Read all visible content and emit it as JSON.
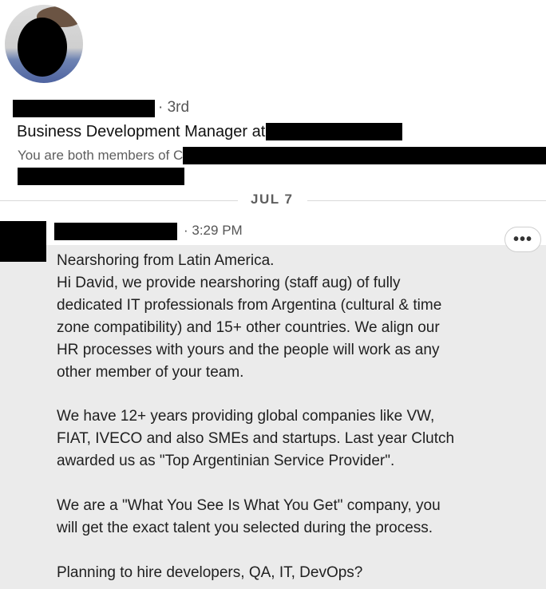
{
  "profile": {
    "degree": "· 3rd",
    "headline_prefix": "Business Development Manager at",
    "shared_prefix": "You are both members of C"
  },
  "divider": {
    "date": "JUL 7"
  },
  "message": {
    "time": "· 3:29 PM",
    "more_label": "•••",
    "lines": [
      "Nearshoring from Latin America.",
      "Hi David, we provide nearshoring (staff aug) of fully",
      "dedicated IT professionals from Argentina (cultural & time",
      "zone compatibility) and 15+ other countries. We align our",
      "HR processes with yours and the people will work as any",
      "other member of your team.",
      "",
      "We have 12+ years providing global companies like VW,",
      "FIAT, IVECO and also SMEs and startups. Last year Clutch",
      "awarded us as \"Top Argentinian Service Provider\".",
      "",
      "We are a \"What You See Is What You Get\" company, you",
      "will get the exact talent you selected during the process.",
      "",
      "Planning to hire developers, QA, IT, DevOps?"
    ]
  }
}
